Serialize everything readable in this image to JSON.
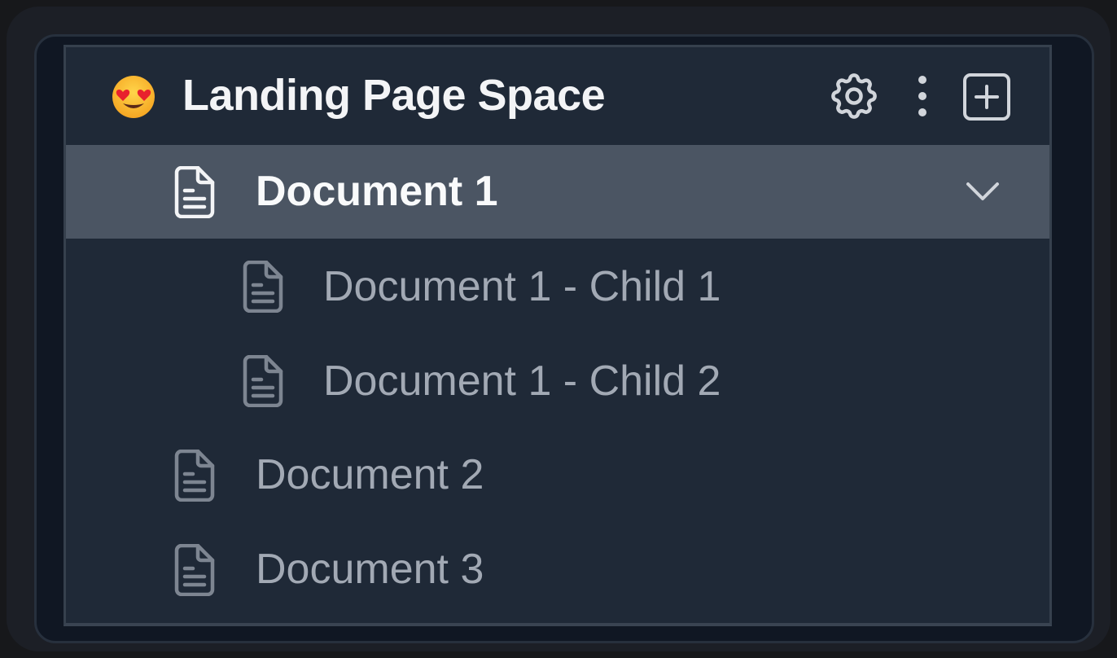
{
  "space": {
    "emoji": "😍",
    "title": "Landing Page Space"
  },
  "header_actions": [
    {
      "icon": "gear-icon"
    },
    {
      "icon": "kebab-menu-icon"
    },
    {
      "icon": "plus-square-icon"
    }
  ],
  "tree": [
    {
      "label": "Document 1",
      "level": 0,
      "active": true,
      "expanded": true
    },
    {
      "label": "Document 1 - Child 1",
      "level": 1,
      "active": false
    },
    {
      "label": "Document 1 - Child 2",
      "level": 1,
      "active": false
    },
    {
      "label": "Document 2",
      "level": 0,
      "active": false
    },
    {
      "label": "Document 3",
      "level": 0,
      "active": false
    }
  ],
  "colors": {
    "panel_bg": "#1f2937",
    "active_bg": "#4b5563",
    "active_text": "#f9fafb",
    "muted_text": "#a2a9b4"
  }
}
